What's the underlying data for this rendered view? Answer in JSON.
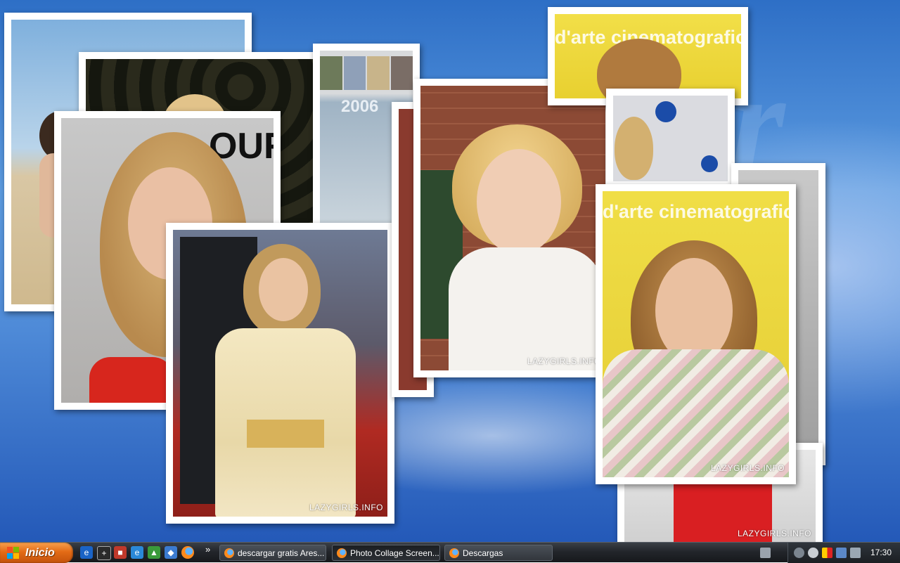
{
  "desktop": {
    "photos": [
      {
        "caption": "",
        "banner": ""
      },
      {
        "caption": "",
        "banner": ""
      },
      {
        "caption": "",
        "year": "2006"
      },
      {
        "caption": "",
        "banner": "d'arte cinematografic"
      },
      {
        "caption": "",
        "banner": "OUR"
      },
      {
        "caption": "LAZYGIRLS.INFO"
      },
      {
        "caption": "LAZYGIRLS.INFO"
      },
      {
        "caption": "",
        "banner": "d'arte cinematografic"
      },
      {
        "caption": "LAZYGIRLS.INFO"
      },
      {
        "caption": "LAZYGIRLS.INFO"
      }
    ]
  },
  "taskbar": {
    "start_label": "Inicio",
    "overflow": "»",
    "tasks": [
      {
        "label": "descargar gratis Ares...",
        "active": false
      },
      {
        "label": "Photo Collage Screen...",
        "active": true
      },
      {
        "label": "Descargas",
        "active": false
      }
    ],
    "clock": "17:30"
  }
}
